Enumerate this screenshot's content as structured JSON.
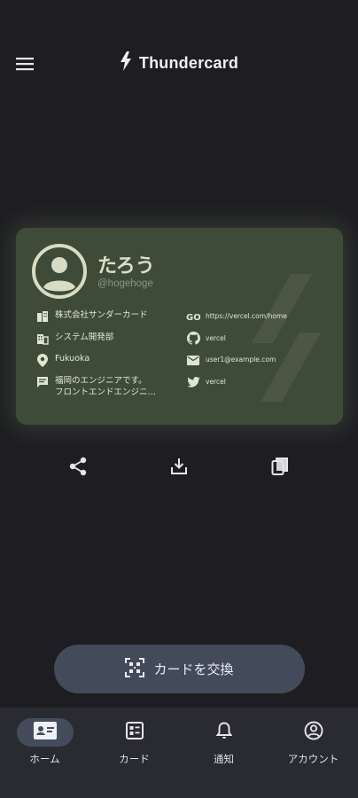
{
  "header": {
    "app_title": "Thundercard",
    "menu_icon": "menu-icon",
    "logo_icon": "bolt-icon"
  },
  "card": {
    "name": "たろう",
    "handle": "@hogehoge",
    "background_color": "#3f4b39",
    "left_info": [
      {
        "icon": "company-icon",
        "text": "株式会社サンダーカード"
      },
      {
        "icon": "department-icon",
        "text": "システム開発部"
      },
      {
        "icon": "location-icon",
        "text": "Fukuoka"
      }
    ],
    "bio": {
      "icon": "comment-icon",
      "line1": "福岡のエンジニアです。",
      "line2": "フロントエンドエンジニ…"
    },
    "right_info": [
      {
        "icon": "link-icon",
        "text": "https://vercel.com/home"
      },
      {
        "icon": "github-icon",
        "text": "vercel"
      },
      {
        "icon": "mail-icon",
        "text": "user1@example.com"
      },
      {
        "icon": "twitter-icon",
        "text": "vercel"
      }
    ]
  },
  "actions": [
    {
      "name": "share",
      "icon": "share-icon"
    },
    {
      "name": "download",
      "icon": "download-icon"
    },
    {
      "name": "copy",
      "icon": "copy-icon"
    }
  ],
  "exchange_button": {
    "label": "カードを交換",
    "icon": "qr-code-icon"
  },
  "bottom_nav": {
    "items": [
      {
        "label": "ホーム",
        "icon": "contact-card-icon",
        "active": true
      },
      {
        "label": "カード",
        "icon": "card-list-icon",
        "active": false
      },
      {
        "label": "通知",
        "icon": "bell-icon",
        "active": false
      },
      {
        "label": "アカウント",
        "icon": "account-circle-icon",
        "active": false
      }
    ]
  },
  "colors": {
    "background": "#1e1e22",
    "nav_background": "#2a2a31",
    "accent_pill": "#444c5c",
    "card_text": "#d9dfc9"
  }
}
